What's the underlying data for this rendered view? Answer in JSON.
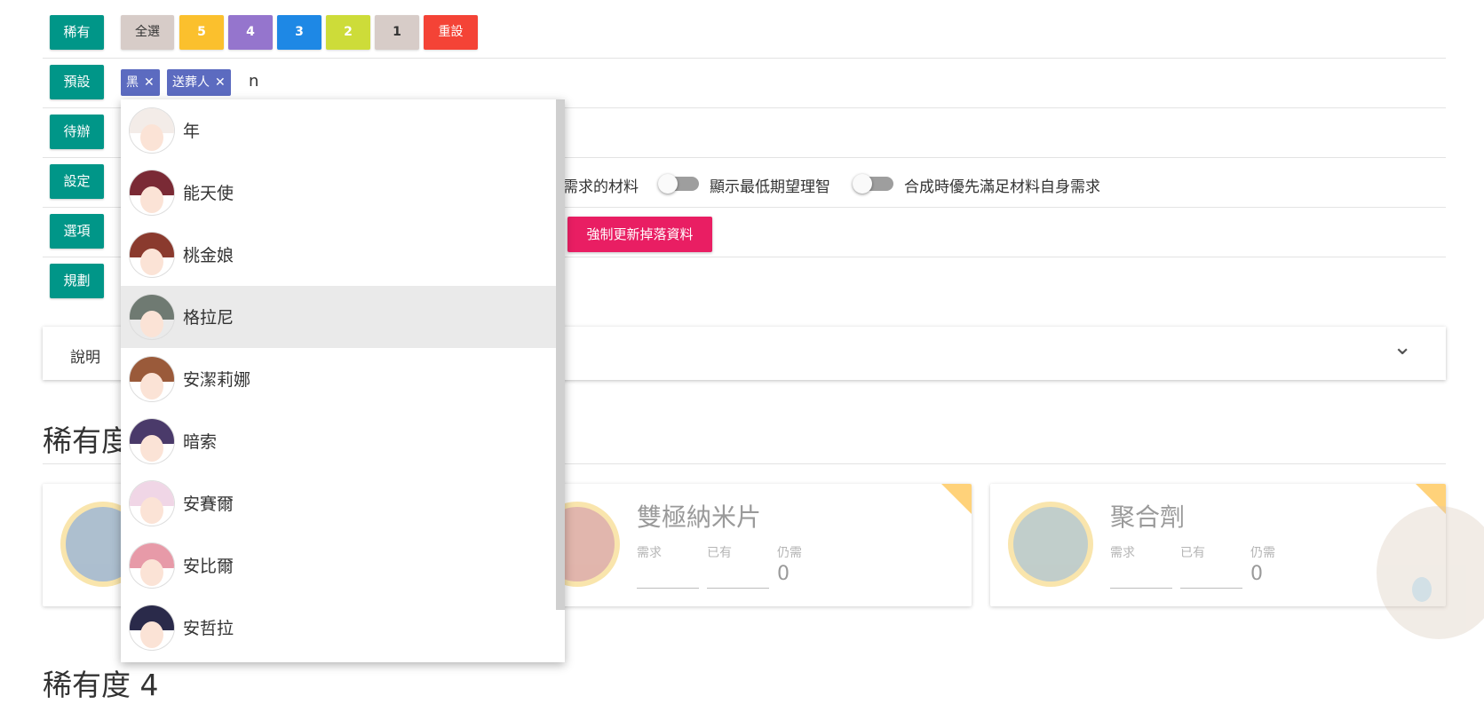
{
  "rows": [
    {
      "label": "稀有"
    },
    {
      "label": "預設"
    },
    {
      "label": "待辦"
    },
    {
      "label": "設定"
    },
    {
      "label": "選項"
    },
    {
      "label": "規劃"
    }
  ],
  "rarity_buttons": [
    {
      "label": "全選",
      "color": "#d7ccc8"
    },
    {
      "label": "5",
      "color": "#fbc02d"
    },
    {
      "label": "4",
      "color": "#9575cd"
    },
    {
      "label": "3",
      "color": "#1e88e5"
    },
    {
      "label": "2",
      "color": "#cddc39"
    },
    {
      "label": "1",
      "color": "#d7ccc8"
    },
    {
      "label": "重設",
      "color": "#f44336"
    }
  ],
  "preset": {
    "chips": [
      "黑",
      "送葬人"
    ],
    "remove_glyph": "✕",
    "input_value": "n"
  },
  "settings": {
    "partial_label": "需求的材料",
    "toggles": [
      {
        "label": "顯示最低期望理智",
        "on": false
      },
      {
        "label": "合成時優先滿足材料自身需求",
        "on": false
      }
    ]
  },
  "options": {
    "force_update_label": "強制更新掉落資料",
    "force_update_color": "#e91e63"
  },
  "explanation": {
    "label": "說明",
    "chevron": "⌄"
  },
  "sections": [
    {
      "title": "稀有度"
    },
    {
      "title": "稀有度 4"
    }
  ],
  "materials": [
    {
      "name": "",
      "need_label": "",
      "have_label": "",
      "remain_label": "",
      "remain_value": ""
    },
    {
      "name": "雙極納米片",
      "need_label": "需求",
      "have_label": "已有",
      "remain_label": "仍需",
      "remain_value": "0"
    },
    {
      "name": "聚合劑",
      "need_label": "需求",
      "have_label": "已有",
      "remain_label": "仍需",
      "remain_value": "0"
    }
  ],
  "dropdown": {
    "highlighted_index": 3,
    "items": [
      {
        "name": "年",
        "hair": "#f3ece8"
      },
      {
        "name": "能天使",
        "hair": "#7a2a35"
      },
      {
        "name": "桃金娘",
        "hair": "#8a3a2e"
      },
      {
        "name": "格拉尼",
        "hair": "#6f7a72"
      },
      {
        "name": "安潔莉娜",
        "hair": "#9a5a3a"
      },
      {
        "name": "暗索",
        "hair": "#4a3a6a"
      },
      {
        "name": "安賽爾",
        "hair": "#f0d6e6"
      },
      {
        "name": "安比爾",
        "hair": "#e79aa8"
      },
      {
        "name": "安哲拉",
        "hair": "#2a2a4a"
      }
    ]
  }
}
